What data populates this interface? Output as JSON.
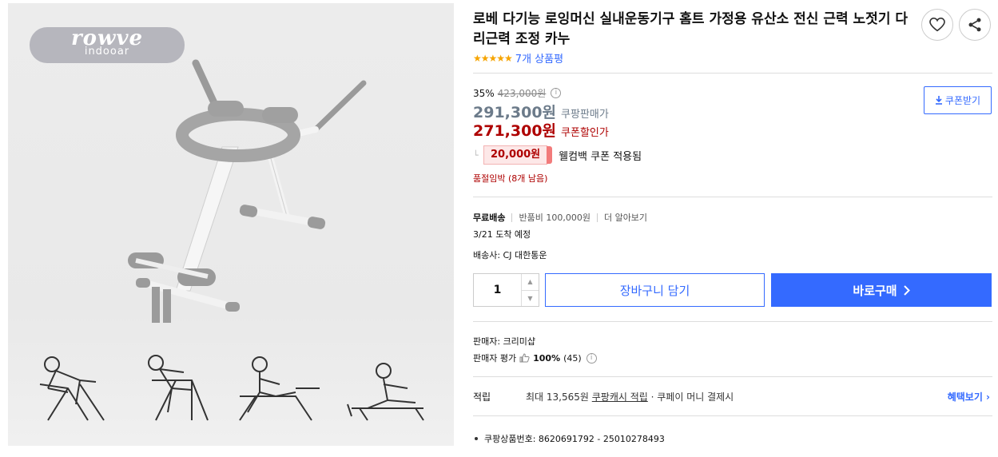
{
  "brand": {
    "name": "rowve",
    "sub": "indooar"
  },
  "product": {
    "title": "로베 다기능 로잉머신 실내운동기구 홈트 가정용 유산소 전신 근력 노젓기 다리근력 조정 카누",
    "stars": "★★★★★",
    "review_count": "7개 상품평"
  },
  "icons": {
    "wishlist": "heart-icon",
    "share": "share-icon",
    "download": "download-icon",
    "info": "info-circle-icon",
    "thumb": "thumbs-up-icon",
    "chevron": "chevron-right-icon"
  },
  "price": {
    "discount_rate": "35%",
    "original_price": "423,000원",
    "sale_price": "291,300원",
    "sale_label": "쿠팡판매가",
    "coupon_price": "271,300원",
    "coupon_label": "쿠폰할인가",
    "coupon_button": "쿠폰받기",
    "welcome_amount": "20,000원",
    "welcome_text": "웰컴백 쿠폰 적용됨",
    "stock_notice": "품절임박 (8개 남음)"
  },
  "shipping": {
    "free": "무료배송",
    "return_fee": "반품비 100,000원",
    "more": "더 알아보기",
    "arrival": "3/21 도착 예정",
    "carrier": "배송사: CJ 대한통운"
  },
  "purchase": {
    "quantity": "1",
    "cart_label": "장바구니 담기",
    "buy_label": "바로구매"
  },
  "seller": {
    "name": "판매자: 크리미샵",
    "rating_label": "판매자 평가",
    "rating_pct": "100%",
    "rating_count": "(45)"
  },
  "reward": {
    "label": "적립",
    "text_prefix": "최대 13,565원 ",
    "text_link": "쿠팡캐시 적립",
    "text_suffix": " · 쿠페이 머니 결제시",
    "benefit_link": "혜택보기"
  },
  "product_id": "쿠팡상품번호: 8620691792 - 25010278493",
  "colors": {
    "accent": "#346aff",
    "price_red": "#ae0000",
    "star": "#f6a400"
  }
}
